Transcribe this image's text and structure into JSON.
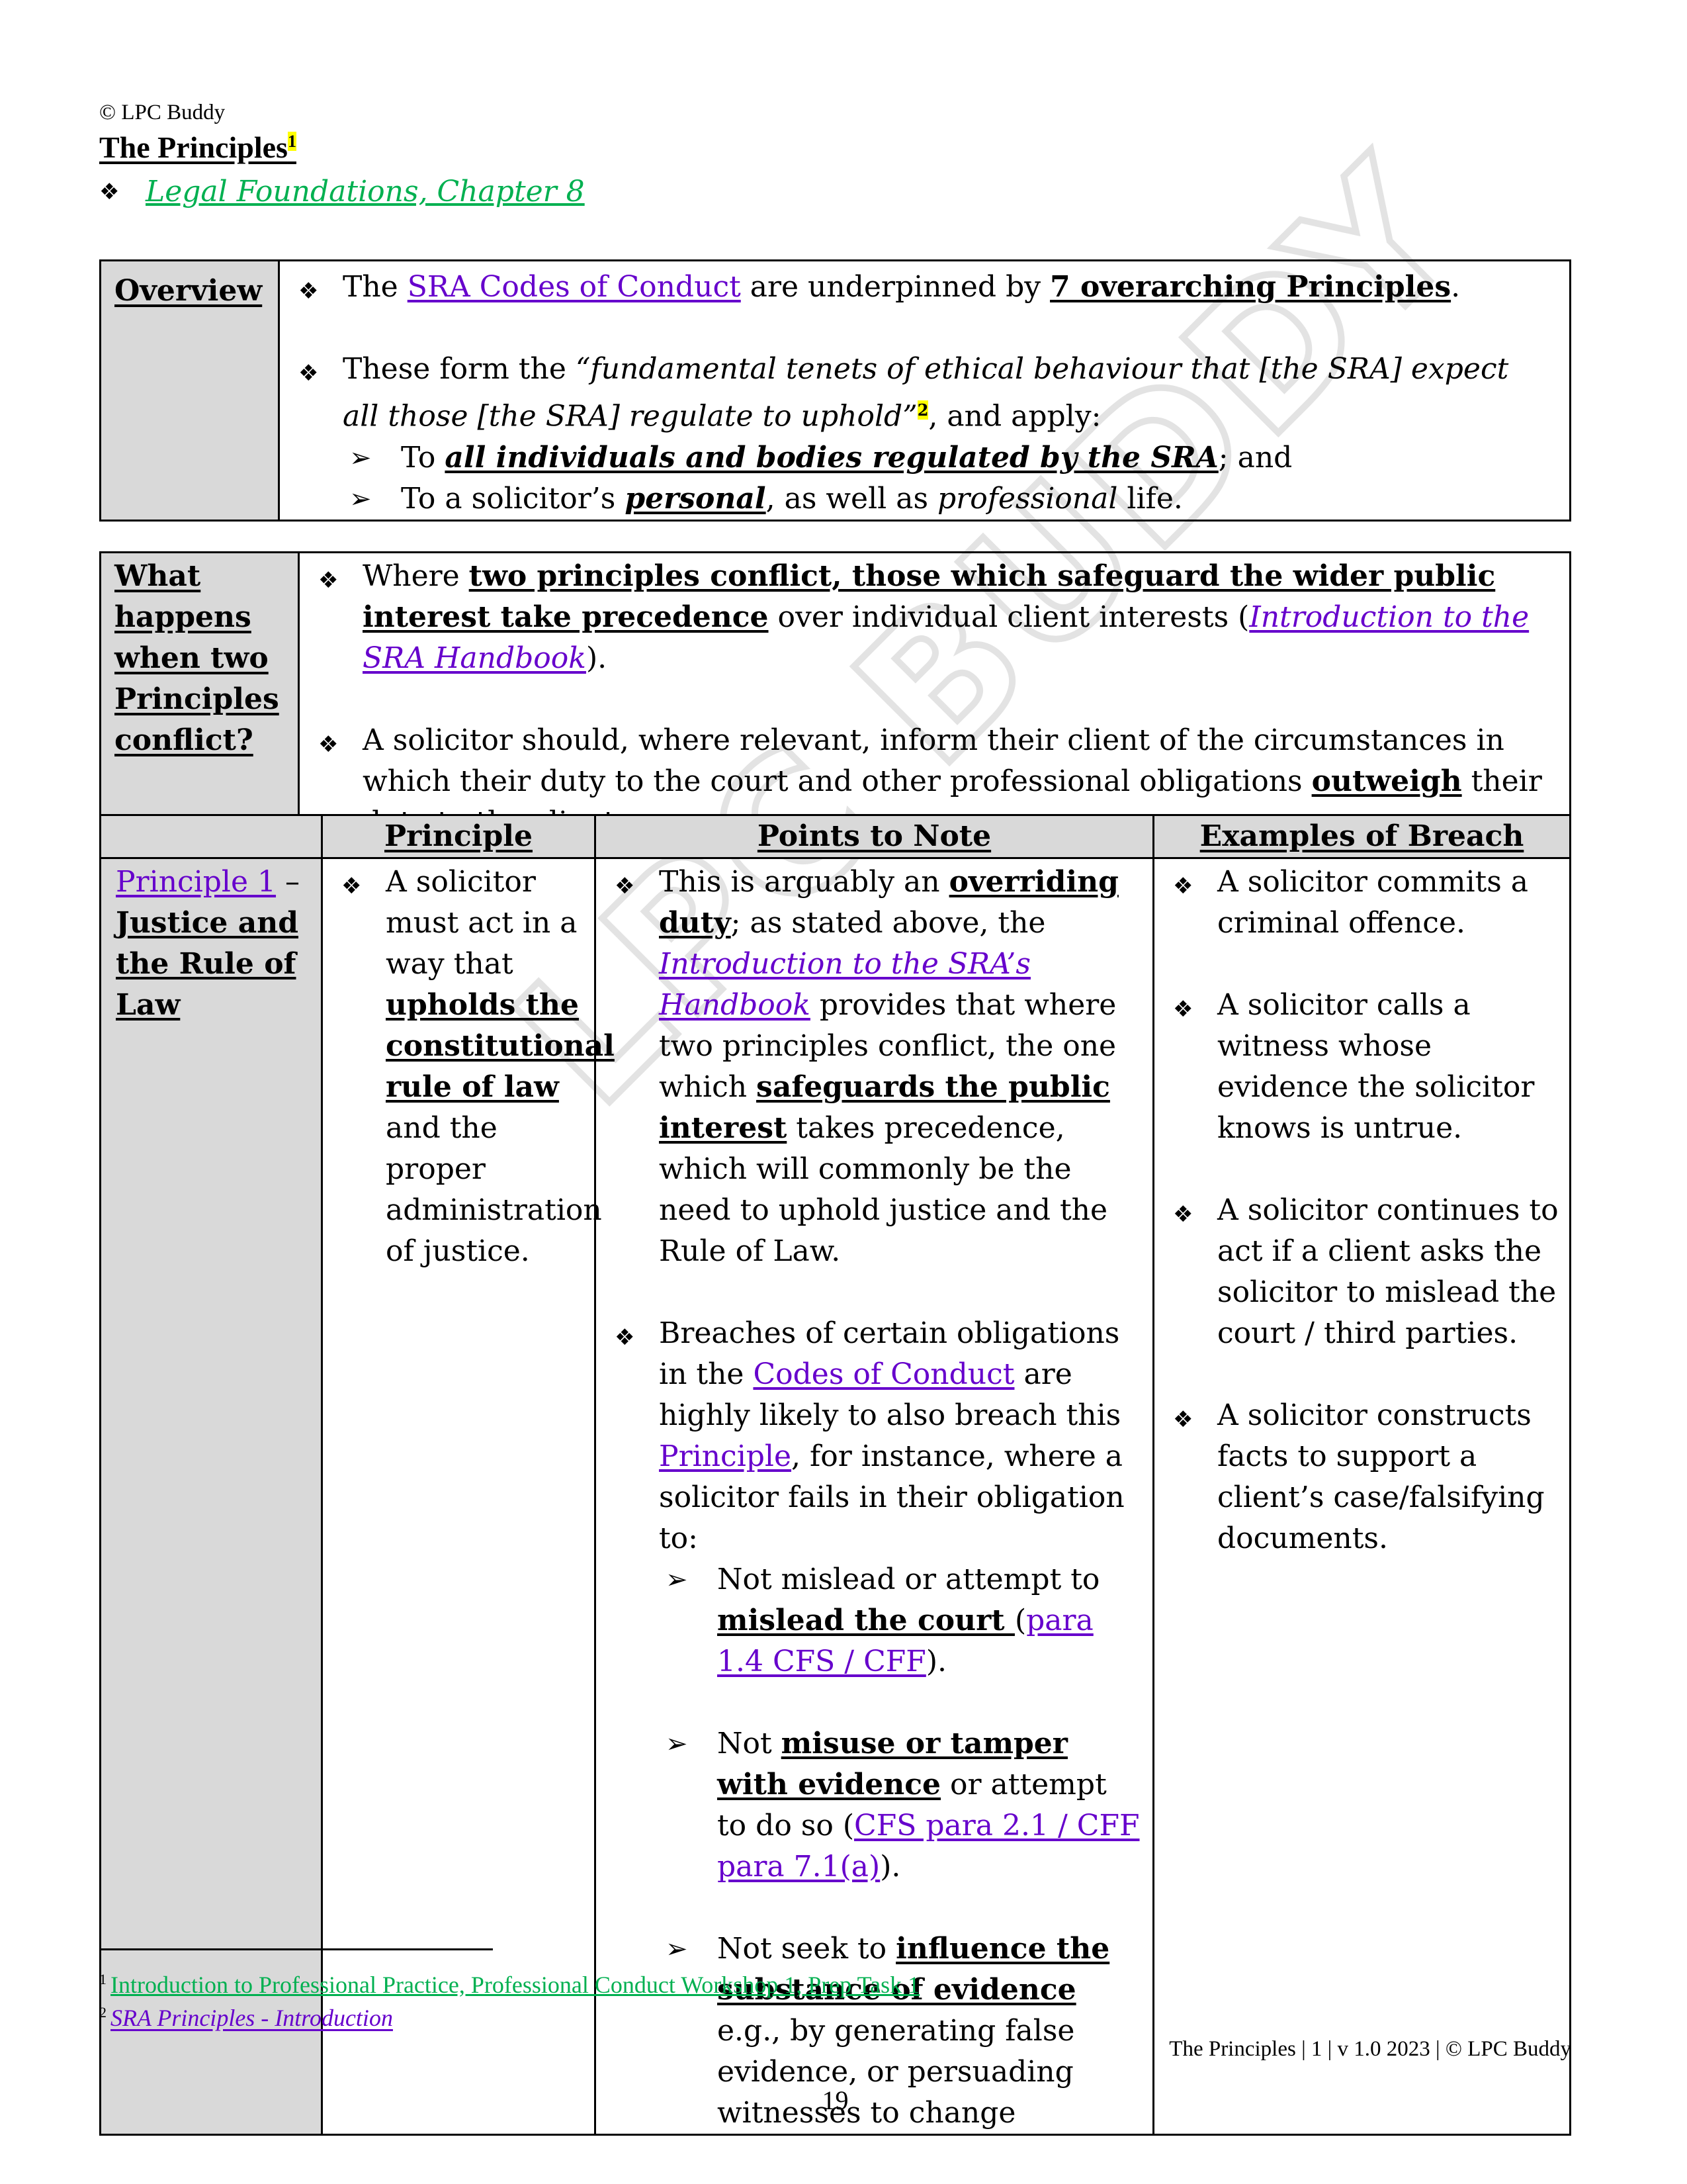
{
  "header": {
    "copyright": "© LPC Buddy",
    "title": "The Principles",
    "title_footnote_ref": "1",
    "reference_link": "Legal Foundations, Chapter 8"
  },
  "overview": {
    "label": "Overview",
    "bullet1": {
      "pre": "The ",
      "link": "SRA Codes of Conduct",
      "mid": " are underpinned by ",
      "emph": "7 overarching Principles",
      "post": "."
    },
    "bullet2": {
      "pre": "These form the ",
      "quote": "“fundamental tenets of ethical behaviour that [the SRA] expect all those [the SRA] regulate to uphold”",
      "footnote_ref": "2",
      "post": ", and apply:"
    },
    "sub1": {
      "pre": "To ",
      "emph": "all individuals and bodies regulated by the SRA",
      "post": "; and"
    },
    "sub2": {
      "pre": "To a solicitor’s ",
      "emph": "personal",
      "mid": ", as well as ",
      "ital": "professional",
      "post": " life."
    }
  },
  "conflict": {
    "label_lines": [
      "What",
      "happens",
      "when two",
      "Principles",
      "conflict?"
    ],
    "bullet1": {
      "pre": "Where ",
      "emph": "two principles conflict, those which safeguard the wider public interest take precedence",
      "mid": " over individual client interests (",
      "link": "Introduction to the SRA Handbook",
      "post": ")."
    },
    "bullet2": {
      "pre": "A solicitor should, where relevant, inform their client of the circumstances in which their duty to the court and other professional obligations ",
      "emph": "outweigh",
      "post": " their duty to the client."
    }
  },
  "principles_table": {
    "headers": [
      "",
      "Principle",
      "Points to Note",
      "Examples of Breach"
    ],
    "row1": {
      "name_link": "Principle 1",
      "name_dash": " –",
      "name_title": "Justice and the Rule of Law",
      "principle": {
        "pre": "A solicitor must act in a way that ",
        "emph": "upholds the constitutional rule of law",
        "post": " and the proper administration of justice."
      },
      "points": {
        "p1": {
          "pre": "This is arguably an ",
          "emph1": "overriding duty",
          "mid1": "; as stated above, the ",
          "link": "Introduction to the SRA’s Handbook",
          "mid2": " provides that where two principles conflict, the one which ",
          "emph2": "safeguards the public interest",
          "post": " takes precedence, which will commonly be the need to uphold justice and the Rule of Law."
        },
        "p2": {
          "pre": "Breaches of certain obligations in the ",
          "link1": "Codes of Conduct",
          "mid": " are highly likely to also breach this ",
          "link2": "Principle",
          "post": ", for instance, where a solicitor fails in their obligation to:"
        },
        "sub1": {
          "pre": "Not mislead or attempt to ",
          "emph": "mislead the court ",
          "open": "(",
          "link": "para 1.4 CFS / CFF",
          "close": ")."
        },
        "sub2": {
          "pre": "Not ",
          "emph": "misuse or tamper with evidence",
          "mid": " or attempt to do so (",
          "link": "CFS para 2.1 / CFF para 7.1(a)",
          "close": ")."
        },
        "sub3": {
          "pre": "Not seek to ",
          "emph": "influence the substance of evidence",
          "post": " e.g., by generating false evidence, or persuading witnesses to change"
        }
      },
      "examples": [
        "A solicitor commits a criminal offence.",
        "A solicitor calls a witness whose evidence the solicitor knows is untrue.",
        "A solicitor continues to act if a client asks the solicitor to mislead the court / third parties.",
        "A solicitor constructs facts to support a client’s case/falsifying documents."
      ]
    }
  },
  "footnotes": [
    {
      "num": "1",
      "text": "Introduction to Professional Practice, Professional Conduct Workshop 1, Prep Task 1"
    },
    {
      "num": "2",
      "text": "SRA Principles - Introduction"
    }
  ],
  "footer": {
    "running": "The Principles | 1 | v 1.0 2023 | © LPC Buddy",
    "page_number": "19"
  },
  "watermark": "LPC BUDDY",
  "icons": {
    "bullet": "❖",
    "arrow": "➢"
  },
  "colors": {
    "link_purple": "#6600cc",
    "link_green": "#00b050",
    "highlight": "#ffff00",
    "label_gray": "#d9d9d9"
  }
}
